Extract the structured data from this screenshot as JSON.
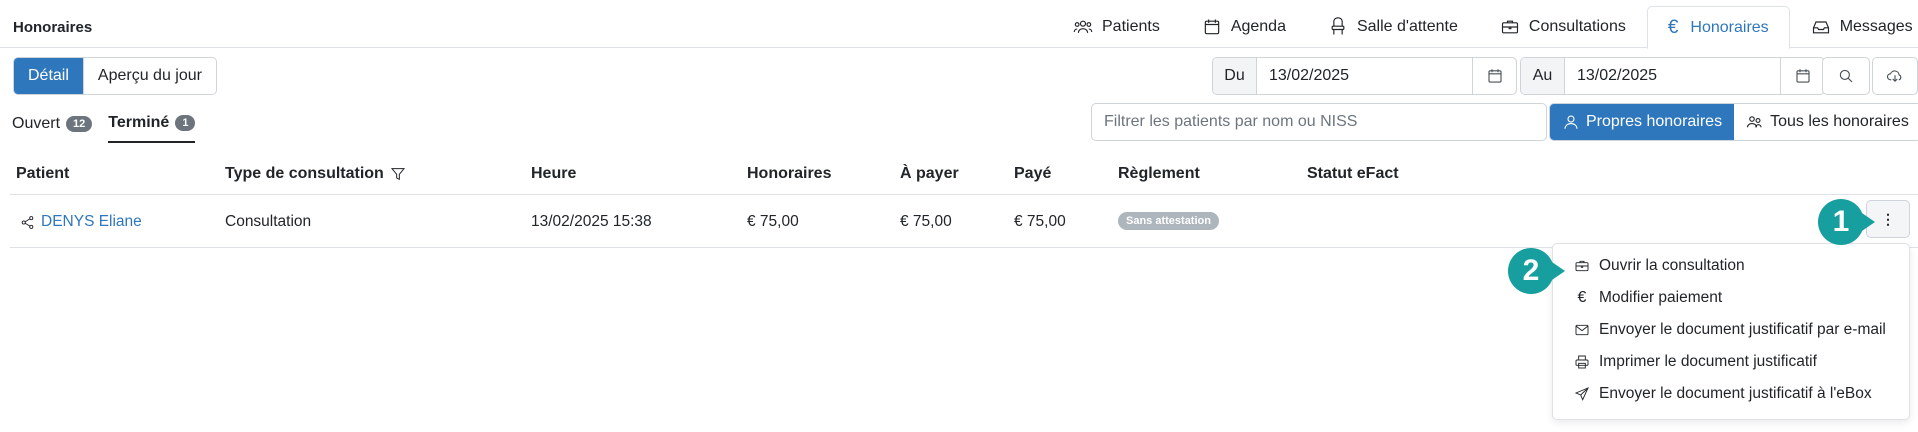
{
  "page": {
    "title": "Honoraires"
  },
  "nav": {
    "tabs": [
      {
        "label": "Patients",
        "icon": "users-icon"
      },
      {
        "label": "Agenda",
        "icon": "calendar-icon"
      },
      {
        "label": "Salle d'attente",
        "icon": "chair-icon"
      },
      {
        "label": "Consultations",
        "icon": "briefcase-icon"
      },
      {
        "label": "Honoraires",
        "icon": "euro-icon",
        "active": true
      },
      {
        "label": "Messages",
        "icon": "inbox-icon"
      }
    ],
    "euro_symbol": "€"
  },
  "view_toggle": {
    "detail": "Détail",
    "day_overview": "Aperçu du jour"
  },
  "date_from": {
    "prefix": "Du",
    "value": "13/02/2025"
  },
  "date_to": {
    "prefix": "Au",
    "value": "13/02/2025"
  },
  "status_tabs": [
    {
      "label": "Ouvert",
      "count": "12"
    },
    {
      "label": "Terminé",
      "count": "1",
      "active": true
    }
  ],
  "filter": {
    "placeholder": "Filtrer les patients par nom ou NISS"
  },
  "scope": {
    "own": "Propres honoraires",
    "all": "Tous les honoraires"
  },
  "table": {
    "headers": {
      "patient": "Patient",
      "type": "Type de consultation",
      "time": "Heure",
      "fees": "Honoraires",
      "to_pay": "À payer",
      "paid": "Payé",
      "settlement": "Règlement",
      "efact": "Statut eFact"
    },
    "rows": [
      {
        "patient": "DENYS Eliane",
        "type": "Consultation",
        "time": "13/02/2025 15:38",
        "fees": "€ 75,00",
        "to_pay": "€ 75,00",
        "paid": "€ 75,00",
        "settlement": "Sans attestation",
        "efact": ""
      }
    ]
  },
  "row_menu": {
    "kebab": "⋮",
    "items": [
      {
        "label": "Ouvrir la consultation",
        "icon": "briefcase-icon"
      },
      {
        "label": "Modifier paiement",
        "icon": "euro-icon"
      },
      {
        "label": "Envoyer le document justificatif par e-mail",
        "icon": "envelope-icon"
      },
      {
        "label": "Imprimer le document justificatif",
        "icon": "printer-icon"
      },
      {
        "label": "Envoyer le document justificatif à l'eBox",
        "icon": "send-icon"
      }
    ]
  },
  "markers": {
    "first": "1",
    "second": "2"
  },
  "colors": {
    "accent": "#2f77bc",
    "marker": "#179e9e",
    "badge": "#adb5bd"
  }
}
